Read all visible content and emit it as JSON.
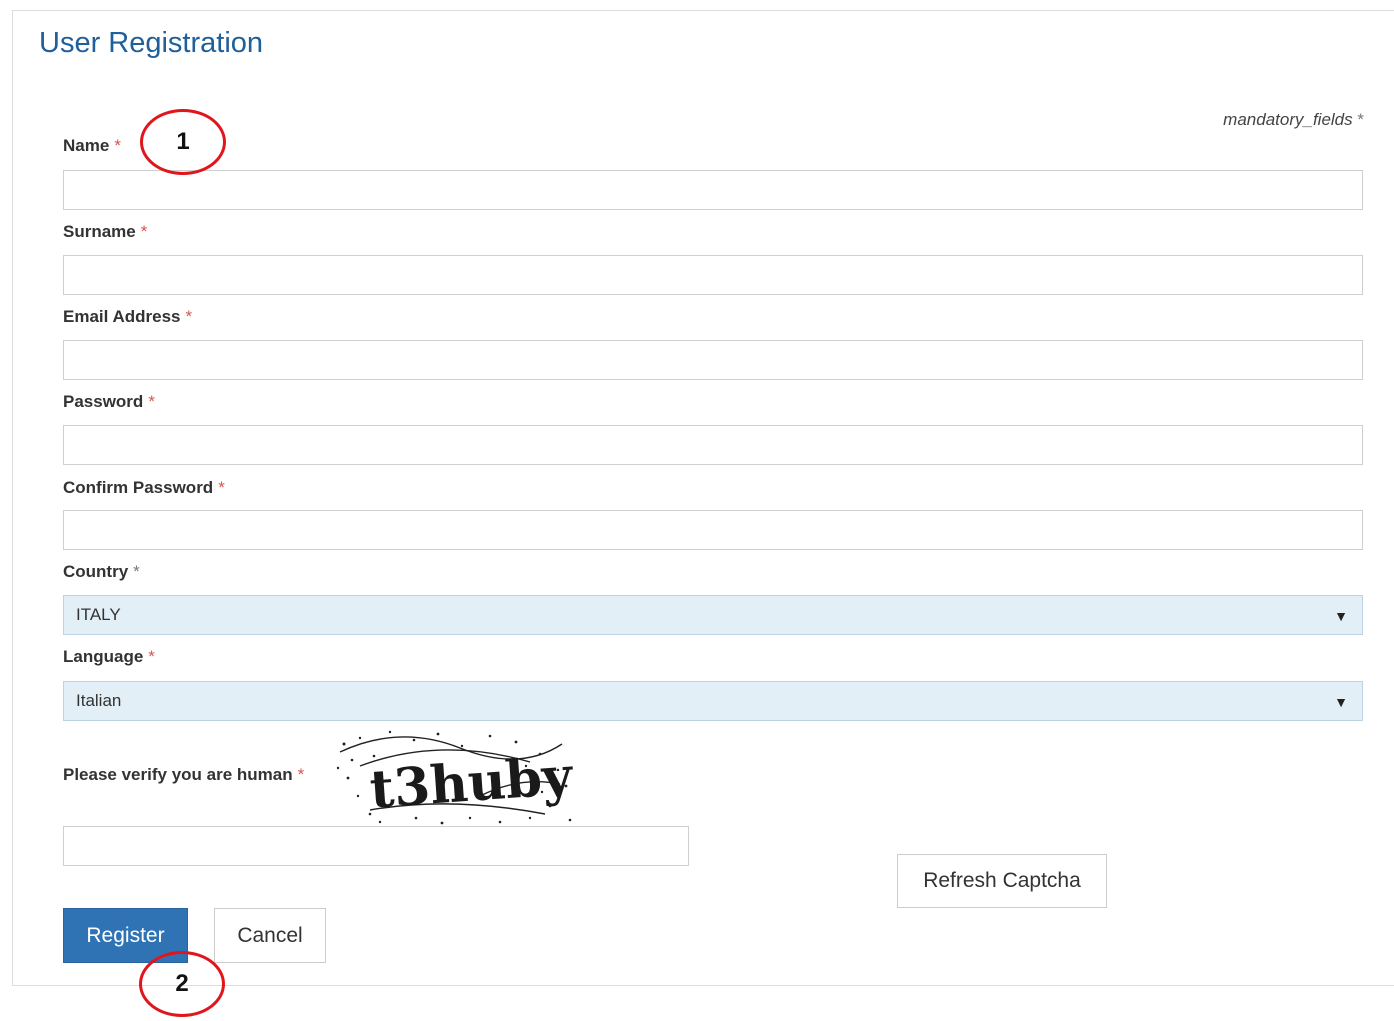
{
  "page": {
    "title": "User Registration",
    "mandatory_note": "mandatory_fields",
    "mandatory_star": "*"
  },
  "form": {
    "fields": [
      {
        "label": "Name",
        "required_mark": "*",
        "value": ""
      },
      {
        "label": "Surname",
        "required_mark": "*",
        "value": ""
      },
      {
        "label": "Email Address",
        "required_mark": "*",
        "value": ""
      },
      {
        "label": "Password",
        "required_mark": "*",
        "value": ""
      },
      {
        "label": "Confirm Password",
        "required_mark": "*",
        "value": ""
      }
    ],
    "country": {
      "label": "Country",
      "required_mark": "*",
      "selected": "ITALY"
    },
    "language": {
      "label": "Language",
      "required_mark": "*",
      "selected": "Italian"
    },
    "captcha": {
      "label": "Please verify you are human",
      "required_mark": "*",
      "image_text": "t3huby",
      "value": ""
    }
  },
  "buttons": {
    "refresh_captcha": "Refresh Captcha",
    "register": "Register",
    "cancel": "Cancel"
  },
  "annotations": {
    "marker_1": "1",
    "marker_2": "2",
    "marker_color": "#e0161d"
  },
  "colors": {
    "title": "#1f5f9a",
    "primary_button": "#2f73b5",
    "required_star": "#d9534f",
    "select_bg": "#e3eff7"
  }
}
